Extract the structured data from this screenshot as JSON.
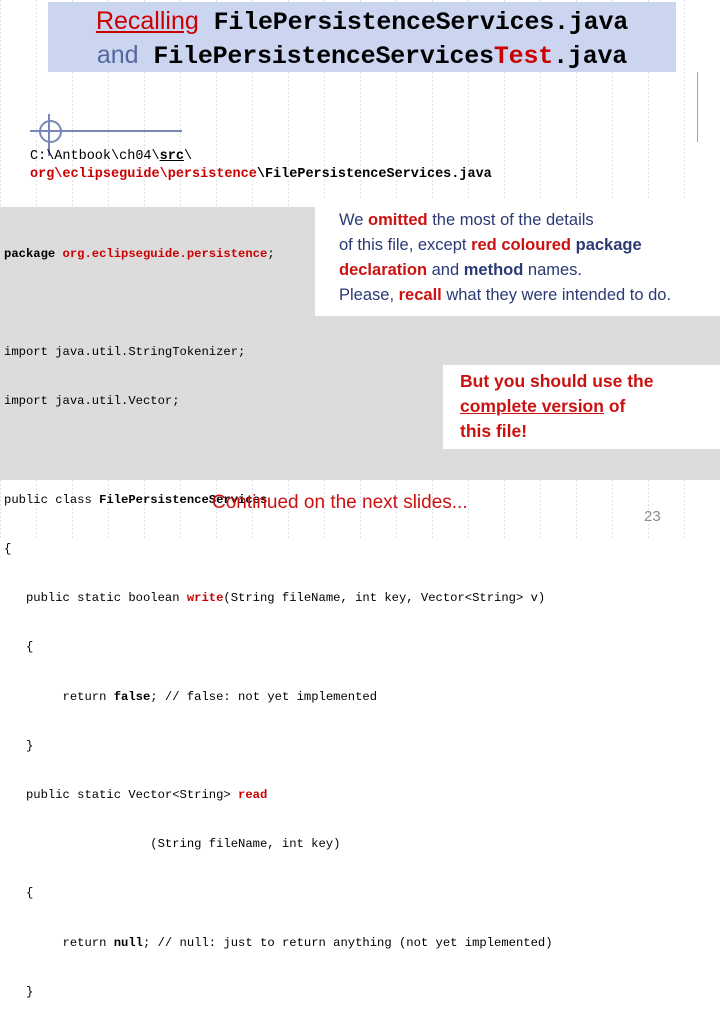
{
  "title": {
    "line1": [
      {
        "text": "Recalling",
        "style": "sans-red-underline"
      },
      {
        "text": " ",
        "style": "plain"
      },
      {
        "text": "FilePersistenceServices.java",
        "style": "mono-bold"
      }
    ],
    "line1_word_recalling": "Recalling",
    "line1_file": "FilePersistenceServices.java",
    "line2_and": "and",
    "line2_file_prefix": "FilePersistenceServices",
    "line2_file_test": "Test",
    "line2_file_suffix": ".java"
  },
  "path": {
    "line1_plain": "C:\\Antbook\\ch04\\",
    "line1_src": "src",
    "line1_tail": "\\",
    "line2_red": "org\\eclipseguide\\persistence",
    "line2_black": "\\FilePersistenceServices.java"
  },
  "code": {
    "l1_kw": "package",
    "l1_pkg": " org.eclipseguide.persistence",
    "l1_end": ";",
    "l2": "",
    "l3": "import java.util.StringTokenizer;",
    "l4": "import java.util.Vector;",
    "l5": "",
    "l6_pre": "public class ",
    "l6_cls": "FilePersistenceServices",
    "l7": "{",
    "l8_pre": "   public static boolean ",
    "l8_m": "write",
    "l8_post": "(String fileName, int key, Vector<String> v)",
    "l9": "   {",
    "l10_pre": "        return ",
    "l10_kw": "false",
    "l10_post": "; // false: not yet implemented",
    "l11": "   }",
    "l12_pre": "   public static Vector<String> ",
    "l12_m": "read",
    "l13": "                    (String fileName, int key)",
    "l14": "   {",
    "l15_pre": "        return ",
    "l15_kw": "null",
    "l15_post": "; // null: just to return anything (not yet implemented)",
    "l16": "   }"
  },
  "note": {
    "l1_a": "We ",
    "l1_b": "omitted",
    "l1_c": " the most of the details",
    "l2_a": "of this file, except ",
    "l2_b": "red coloured",
    "l2_c": " ",
    "l2_d": "package",
    "l3_a": "declaration",
    "l3_b": " and ",
    "l3_c": "method",
    "l3_d": " names.",
    "l4_a": "Please, ",
    "l4_b": "recall",
    "l4_c": " what they were intended to do."
  },
  "callout": {
    "l1": "But you should use the",
    "l2_a": "complete version",
    "l2_b": " of",
    "l3": "this file!"
  },
  "footer": {
    "note": "Continued on the next slides...",
    "page": "23"
  },
  "colors": {
    "title_band": "#ccd5f0",
    "accent_red": "#cc0000",
    "note_blue": "#2b3a74",
    "code_bg": "#dcdcdc",
    "rule_blue": "#7b86b8",
    "page_gray": "#8d8d8d"
  }
}
